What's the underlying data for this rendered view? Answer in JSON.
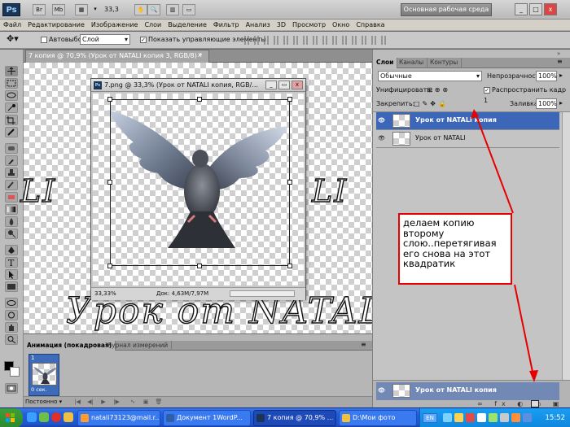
{
  "app": {
    "logo": "Ps",
    "zoom": "33,3",
    "workspace_button": "Основная рабочая среда",
    "win_min": "_",
    "win_max": "□",
    "win_close": "x"
  },
  "menu": [
    "Файл",
    "Редактирование",
    "Изображение",
    "Слои",
    "Выделение",
    "Фильтр",
    "Анализ",
    "3D",
    "Просмотр",
    "Окно",
    "Справка"
  ],
  "options": {
    "autoselect_label": "Автовыбор:",
    "autoselect_value": "Слой",
    "show_controls_label": "Показать управляющие элементы"
  },
  "document": {
    "tab_title": "7 копия @ 70,9% (Урок от  NATALI копия 3, RGB/8) *",
    "canvas_text": "Урок от NATALI",
    "canvas_text_left_fragment": "LI",
    "canvas_text_right_fragment": "LI"
  },
  "inner_document": {
    "title": "7.png @ 33,3% (Урок от  NATALI копия, RGB/...",
    "ps_icon": "Ps",
    "zoom_status": "33,33%",
    "doc_status": "Док: 4,63M/7,97M"
  },
  "panel": {
    "tabs": [
      "Слои",
      "Каналы",
      "Контуры"
    ],
    "blend_mode": "Обычные",
    "opacity_label": "Непрозрачность:",
    "opacity_value": "100%",
    "unify_label": "Унифицировать:",
    "propagate_label": "Распространить кадр 1",
    "lock_label": "Закрепить:",
    "fill_label": "Заливка:",
    "fill_value": "100%",
    "layers": [
      {
        "name": "Урок от  NATALI копия",
        "selected": true
      },
      {
        "name": "Урок от  NATALI",
        "selected": false
      }
    ],
    "dragged_layer": "Урок от  NATALI копия"
  },
  "callout": {
    "text": "делаем копию второму слою..перетягивая его  снова на этот квадратик",
    "border_color": "#e60000"
  },
  "animation": {
    "tabs": [
      "Анимация (покадровая)",
      "Журнал измерений"
    ],
    "frame_number": "1",
    "frame_time": "0 сек.",
    "loop": "Постоянно"
  },
  "taskbar": {
    "tasks": [
      {
        "label": "natali73123@mail.r...",
        "active": false
      },
      {
        "label": "Документ 1WordP...",
        "active": false
      },
      {
        "label": "7 копия @ 70,9% ...",
        "active": true
      },
      {
        "label": "D:\\Мои фото",
        "active": false
      }
    ],
    "language": "EN",
    "clock": "15:52"
  },
  "colors": {
    "selection": "#3c66b8",
    "taskbar": "#245edb",
    "arrow": "#e60000"
  }
}
